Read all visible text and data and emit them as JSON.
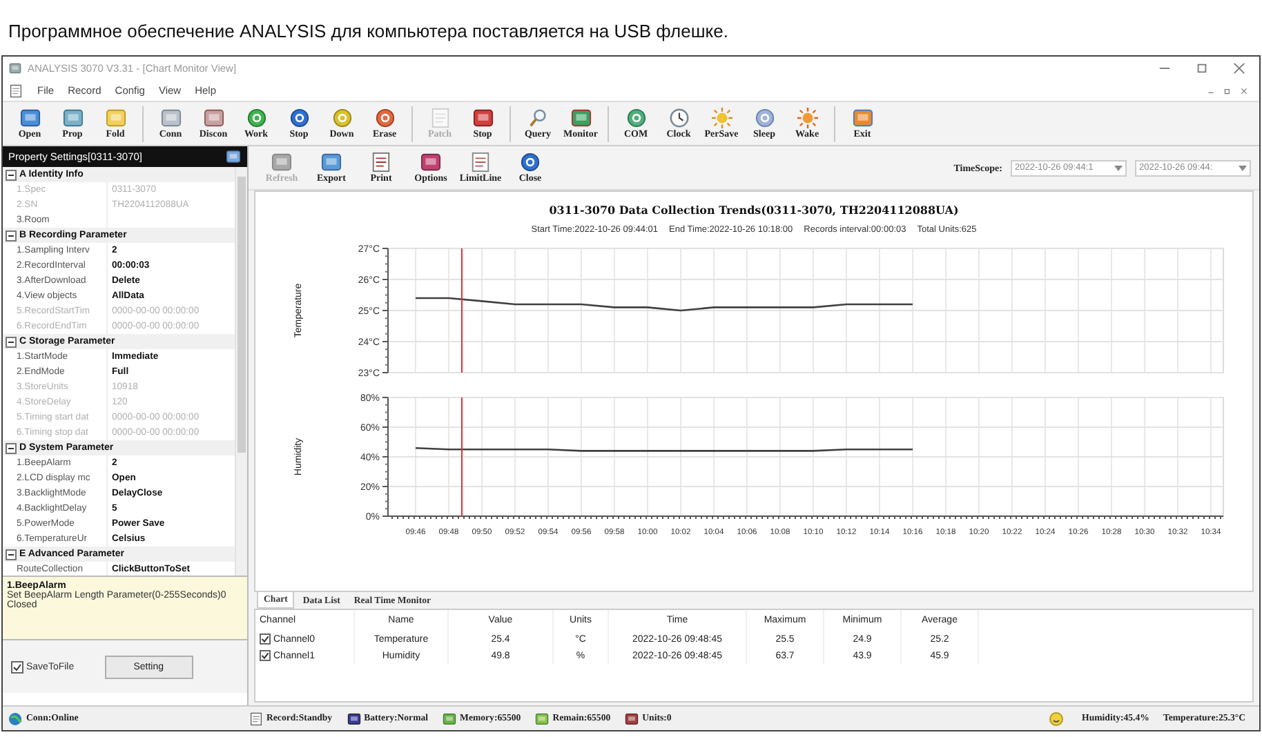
{
  "caption": "Программное обеспечение ANALYSIS для компьютера поставляется на USB флешке.",
  "window": {
    "title": "ANALYSIS 3070 V3.31 - [Chart Monitor View]"
  },
  "menu": [
    "File",
    "Record",
    "Config",
    "View",
    "Help"
  ],
  "toolbar": {
    "groups": [
      {
        "buttons": [
          {
            "label": "Open",
            "disabled": false
          },
          {
            "label": "Prop",
            "disabled": false
          },
          {
            "label": "Fold",
            "disabled": false
          }
        ]
      },
      {
        "buttons": [
          {
            "label": "Conn",
            "disabled": false
          },
          {
            "label": "Discon",
            "disabled": false
          },
          {
            "label": "Work",
            "disabled": false
          },
          {
            "label": "Stop",
            "disabled": false
          },
          {
            "label": "Down",
            "disabled": false
          },
          {
            "label": "Erase",
            "disabled": false
          }
        ]
      },
      {
        "buttons": [
          {
            "label": "Patch",
            "disabled": true
          },
          {
            "label": "Stop",
            "disabled": false
          }
        ]
      },
      {
        "buttons": [
          {
            "label": "Query",
            "disabled": false
          },
          {
            "label": "Monitor",
            "disabled": false
          }
        ]
      },
      {
        "buttons": [
          {
            "label": "COM",
            "disabled": false
          },
          {
            "label": "Clock",
            "disabled": false
          },
          {
            "label": "PerSave",
            "disabled": false
          },
          {
            "label": "Sleep",
            "disabled": false
          },
          {
            "label": "Wake",
            "disabled": false
          }
        ]
      },
      {
        "buttons": [
          {
            "label": "Exit",
            "disabled": false
          }
        ]
      }
    ]
  },
  "properties": {
    "title": "Property Settings[0311-3070]",
    "categories": [
      {
        "name": "A Identity Info",
        "expanded": true,
        "items": [
          {
            "label": "1.Spec",
            "value": "0311-3070",
            "disabled": true
          },
          {
            "label": "2.SN",
            "value": "TH2204112088UA",
            "disabled": true
          },
          {
            "label": "3.Room",
            "disabled": false
          }
        ]
      },
      {
        "name": "B Recording Parameter",
        "expanded": true,
        "items": [
          {
            "label": "1.Sampling Interv",
            "value": "2",
            "disabled": false
          },
          {
            "label": "2.RecordInterval",
            "value": "00:00:03",
            "disabled": false
          },
          {
            "label": "3.AfterDownload",
            "value": "Delete",
            "disabled": false
          },
          {
            "label": "4.View objects",
            "value": "AllData",
            "disabled": false
          },
          {
            "label": "5.RecordStartTim",
            "value": "0000-00-00 00:00:00",
            "disabled": true
          },
          {
            "label": "6.RecordEndTim",
            "value": "0000-00-00 00:00:00",
            "disabled": true
          }
        ]
      },
      {
        "name": "C Storage Parameter",
        "expanded": true,
        "items": [
          {
            "label": "1.StartMode",
            "value": "Immediate",
            "disabled": false
          },
          {
            "label": "2.EndMode",
            "value": "Full",
            "disabled": false
          },
          {
            "label": "3.StoreUnits",
            "value": "10918",
            "disabled": true
          },
          {
            "label": "4.StoreDelay",
            "value": "120",
            "disabled": true
          },
          {
            "label": "5.Timing start dat",
            "value": "0000-00-00 00:00:00",
            "disabled": true
          },
          {
            "label": "6.Timing stop dat",
            "value": "0000-00-00 00:00:00",
            "disabled": true
          }
        ]
      },
      {
        "name": "D System Parameter",
        "expanded": true,
        "items": [
          {
            "label": "1.BeepAlarm",
            "value": "2",
            "disabled": false
          },
          {
            "label": "2.LCD display mc",
            "value": "Open",
            "disabled": false
          },
          {
            "label": "3.BacklightMode",
            "value": "DelayClose",
            "disabled": false
          },
          {
            "label": "4.BacklightDelay",
            "value": "5",
            "disabled": false
          },
          {
            "label": "5.PowerMode",
            "value": "Power Save",
            "disabled": false
          },
          {
            "label": "6.TemperatureUr",
            "value": "Celsius",
            "disabled": false
          }
        ]
      },
      {
        "name": "E Advanced Parameter",
        "expanded": true,
        "items": [
          {
            "label": "RouteCollection",
            "value": "ClickButtonToSet",
            "disabled": false
          }
        ]
      }
    ]
  },
  "description": {
    "title": "1.BeepAlarm",
    "text": "Set BeepAlarm Length Parameter(0-255Seconds)0 Closed"
  },
  "save_to_file": {
    "label": "SaveToFile",
    "checked": true
  },
  "setting_button": "Setting",
  "view_toolbar": {
    "buttons": [
      {
        "label": "Refresh",
        "disabled": true
      },
      {
        "label": "Export",
        "disabled": false
      },
      {
        "label": "Print",
        "disabled": false
      },
      {
        "label": "Options",
        "disabled": false
      },
      {
        "label": "LimitLine",
        "disabled": false
      },
      {
        "label": "Close",
        "disabled": false
      }
    ],
    "time_scope": {
      "label": "TimeScope:",
      "start": "2022-10-26 09:44:1",
      "end": "2022-10-26 09:44:"
    }
  },
  "chart_panel": {
    "title": "0311-3070 Data Collection Trends(0311-3070, TH2204112088UA)",
    "subtitle": [
      "Start Time:2022-10-26 09:44:01",
      "End Time:2022-10-26 10:18:00",
      "Records interval:00:00:03",
      "Total Units:625"
    ],
    "charts": [
      {
        "chart_data": {
          "type": "line",
          "ylabel": "Temperature",
          "grid": true,
          "series": [
            {
              "color": "#404040",
              "values": [
                25.4,
                25.4,
                25.3,
                25.2,
                25.2,
                25.2,
                25.1,
                25.1,
                25.0,
                25.1,
                25.1,
                25.1,
                25.1,
                25.2,
                25.2,
                25.2,
                null,
                null,
                null,
                null,
                null,
                null,
                null,
                null,
                null
              ]
            }
          ],
          "ylim": [
            23,
            27
          ],
          "yticks": [
            {
              "value": 23,
              "label": "23°C"
            },
            {
              "value": 24,
              "label": "24°C"
            },
            {
              "value": 25,
              "label": "25°C"
            },
            {
              "value": 26,
              "label": "26°C"
            },
            {
              "value": 27,
              "label": "27°C"
            }
          ]
        }
      },
      {
        "chart_data": {
          "type": "line",
          "ylabel": "Humidity",
          "grid": true,
          "categories": [
            "09:46",
            "09:48",
            "09:50",
            "09:52",
            "09:54",
            "09:56",
            "09:58",
            "10:00",
            "10:02",
            "10:04",
            "10:06",
            "10:08",
            "10:10",
            "10:12",
            "10:14",
            "10:16",
            "10:18",
            "10:20",
            "10:22",
            "10:24",
            "10:26",
            "10:28",
            "10:30",
            "10:32",
            "10:34"
          ],
          "series": [
            {
              "color": "#404040",
              "values": [
                46,
                45,
                45,
                45,
                45,
                44,
                44,
                44,
                44,
                44,
                44,
                44,
                44,
                45,
                45,
                45,
                null,
                null,
                null,
                null,
                null,
                null,
                null,
                null,
                null
              ]
            }
          ],
          "ylim": [
            0,
            80
          ],
          "yticks": [
            {
              "value": 0,
              "label": "0%"
            },
            {
              "value": 20,
              "label": "20%"
            },
            {
              "value": 40,
              "label": "40%"
            },
            {
              "value": 60,
              "label": "60%"
            },
            {
              "value": 80,
              "label": "80%"
            }
          ]
        }
      }
    ]
  },
  "tabs": [
    {
      "label": "Chart",
      "selected": true
    },
    {
      "label": "Data List",
      "selected": false
    },
    {
      "label": "Real Time Monitor",
      "selected": false
    }
  ],
  "table": {
    "columns": [
      "Channel",
      "Name",
      "Value",
      "Units",
      "Time",
      "Maximum",
      "Minimum",
      "Average"
    ],
    "rows": [
      {
        "checked": true,
        "cells": [
          "Channel0",
          "Temperature",
          "25.4",
          "°C",
          "2022-10-26 09:48:45",
          "25.5",
          "24.9",
          "25.2"
        ]
      },
      {
        "checked": true,
        "cells": [
          "Channel1",
          "Humidity",
          "49.8",
          "%",
          "2022-10-26 09:48:45",
          "63.7",
          "43.9",
          "45.9"
        ]
      }
    ]
  },
  "status_bar": {
    "connection": "Conn:Online",
    "items": [
      "Record:Standby",
      "Battery:Normal",
      "Memory:65500",
      "Remain:65500",
      "Units:0"
    ],
    "readings": [
      "Humidity:45.4%",
      "Temperature:25.3°C"
    ]
  }
}
